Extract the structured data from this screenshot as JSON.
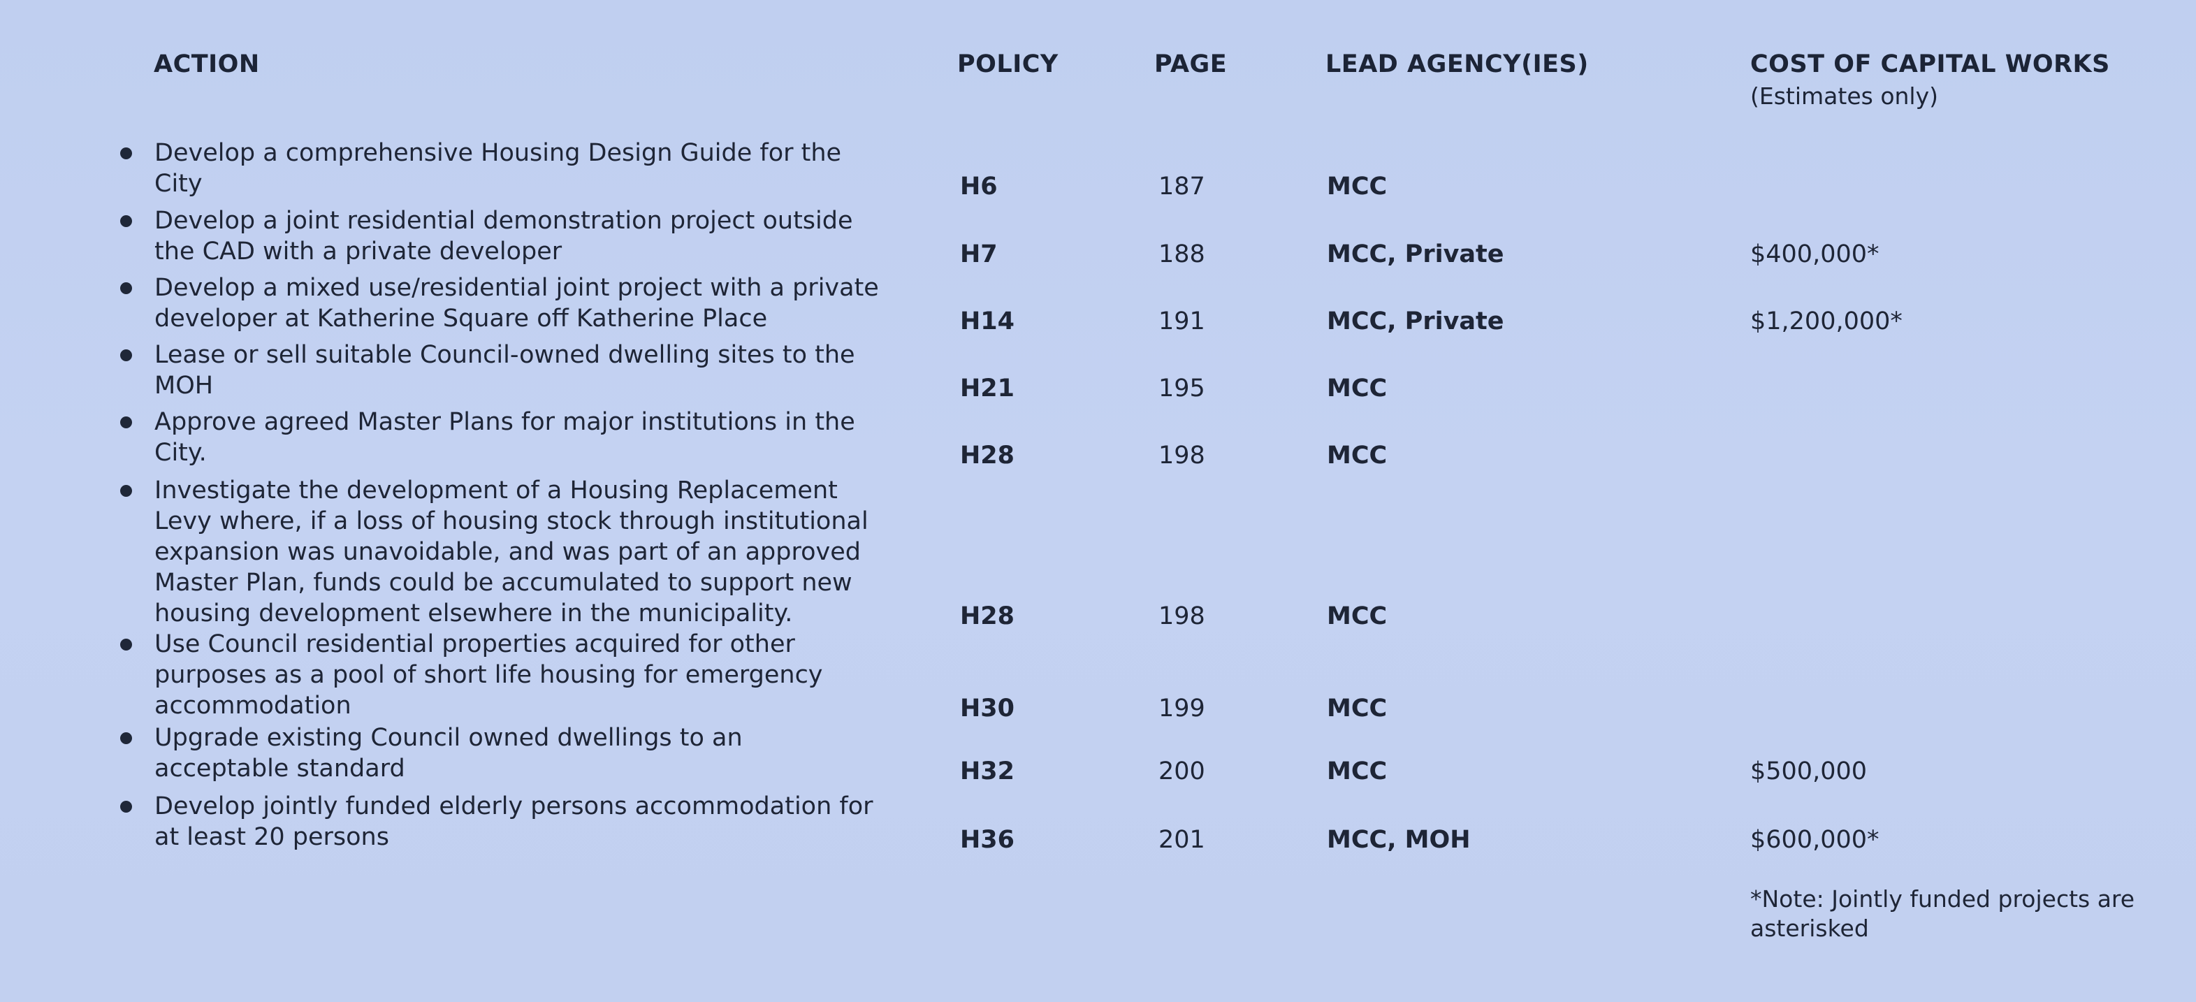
{
  "headers": {
    "action": "ACTION",
    "policy": "POLICY",
    "page": "PAGE",
    "lead": "LEAD AGENCY(IES)",
    "cost": "COST OF CAPITAL WORKS",
    "cost_sub": "(Estimates only)"
  },
  "rows": [
    {
      "action_lines": [
        "Develop a comprehensive Housing Design Guide for the",
        "City"
      ],
      "policy": "H6",
      "page": "187",
      "lead": "MCC",
      "cost": ""
    },
    {
      "action_lines": [
        "Develop a joint residential demonstration project outside",
        "the CAD with a private developer"
      ],
      "policy": "H7",
      "page": "188",
      "lead": "MCC, Private",
      "cost": "$400,000*"
    },
    {
      "action_lines": [
        "Develop a mixed use/residential joint project with a private",
        "developer at Katherine Square off Katherine Place"
      ],
      "policy": "H14",
      "page": "191",
      "lead": "MCC, Private",
      "cost": "$1,200,000*"
    },
    {
      "action_lines": [
        "Lease or sell suitable Council-owned dwelling sites to the",
        "MOH"
      ],
      "policy": "H21",
      "page": "195",
      "lead": "MCC",
      "cost": ""
    },
    {
      "action_lines": [
        "Approve agreed Master Plans for major institutions in the",
        "City."
      ],
      "policy": "H28",
      "page": "198",
      "lead": "MCC",
      "cost": ""
    },
    {
      "action_lines": [
        "Investigate the development of a Housing Replacement",
        "Levy where, if a loss of housing stock through institutional",
        "expansion was unavoidable, and was part of an approved",
        "Master Plan, funds could be accumulated to support new",
        "housing development elsewhere in the municipality."
      ],
      "policy": "H28",
      "page": "198",
      "lead": "MCC",
      "cost": ""
    },
    {
      "action_lines": [
        "Use Council residential properties acquired for other",
        "purposes as a pool of short life housing for emergency",
        "accommodation"
      ],
      "policy": "H30",
      "page": "199",
      "lead": "MCC",
      "cost": ""
    },
    {
      "action_lines": [
        "Upgrade existing Council owned dwellings to an",
        "acceptable standard"
      ],
      "policy": "H32",
      "page": "200",
      "lead": "MCC",
      "cost": "$500,000"
    },
    {
      "action_lines": [
        "Develop jointly funded elderly persons accommodation for",
        "at least 20 persons"
      ],
      "policy": "H36",
      "page": "201",
      "lead": "MCC, MOH",
      "cost": "$600,000*"
    }
  ],
  "note_lines": [
    "*Note: Jointly funded projects are",
    "asterisked"
  ]
}
